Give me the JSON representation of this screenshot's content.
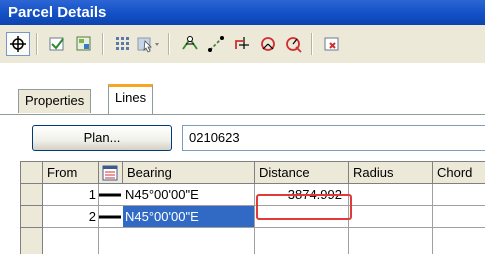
{
  "window": {
    "title": "Parcel Details"
  },
  "toolbar": {
    "buttons": [
      "pick-point-icon",
      "check-icon",
      "table-view-icon",
      "grid-select-icon",
      "select-dropdown-icon",
      "insert-vertex-icon",
      "line-icon",
      "add-segment-icon",
      "curve-icon",
      "delete-curve-icon",
      "close-window-icon"
    ]
  },
  "tabs": [
    {
      "label": "Properties"
    },
    {
      "label": "Lines"
    }
  ],
  "plan": {
    "button_label": "Plan...",
    "value": "0210623"
  },
  "grid": {
    "columns": [
      "From",
      "Bearing",
      "Distance",
      "Radius",
      "Chord"
    ],
    "rows": [
      {
        "from": "1",
        "bearing": "N45°00'00\"E",
        "distance": "3874.992",
        "radius": "",
        "chord": ""
      },
      {
        "from": "2",
        "bearing": "N45°00'00\"E",
        "distance": "",
        "radius": "",
        "chord": ""
      }
    ]
  },
  "colors": {
    "title_bar": "#1552c8",
    "selection": "#316ac5",
    "highlight_border": "#e03a3a",
    "active_tab_accent": "#f5a623"
  }
}
